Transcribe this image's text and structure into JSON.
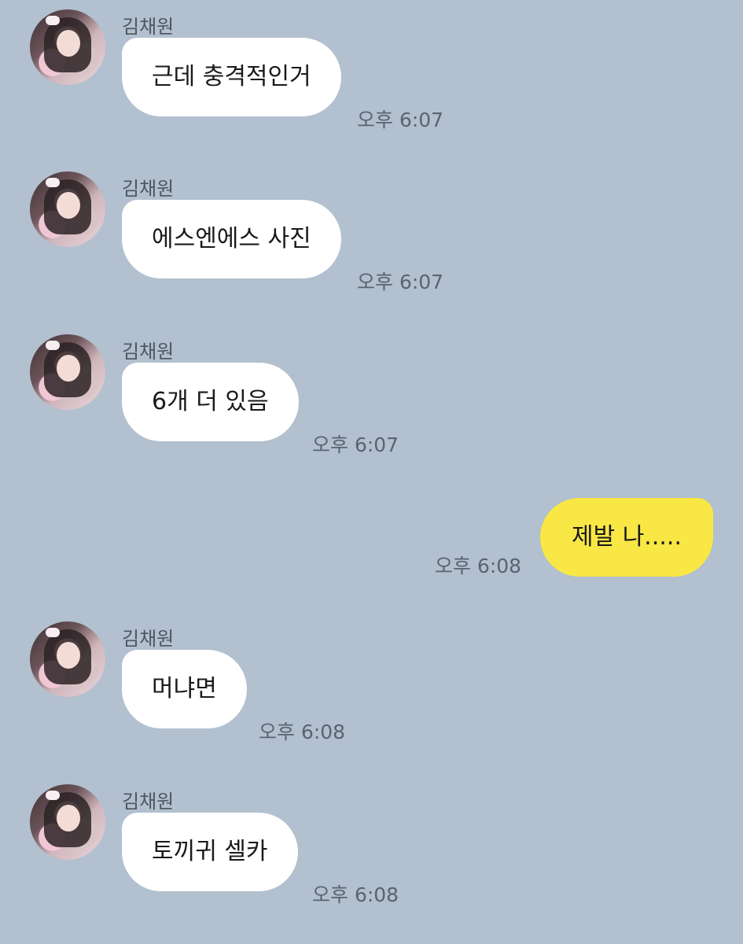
{
  "messages": [
    {
      "sender": "김채원",
      "text": "근데 충격적인거",
      "time": "오후 6:07"
    },
    {
      "sender": "김채원",
      "text": "에스엔에스 사진",
      "time": "오후 6:07"
    },
    {
      "sender": "김채원",
      "text": "6개 더 있음",
      "time": "오후 6:07"
    },
    {
      "sender": "me",
      "text": "제발 나.....",
      "time": "오후 6:08"
    },
    {
      "sender": "김채원",
      "text": "머냐면",
      "time": "오후 6:08"
    },
    {
      "sender": "김채원",
      "text": "토끼귀 셀카",
      "time": "오후 6:08"
    }
  ],
  "icons": {
    "avatar": "profile-photo-avatar"
  },
  "colors": {
    "background": "#b2c0cf",
    "incoming_bubble": "#ffffff",
    "outgoing_bubble": "#f8e744"
  }
}
